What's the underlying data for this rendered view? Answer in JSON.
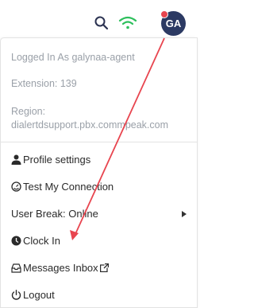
{
  "header": {
    "avatar_initials": "GA",
    "icons": [
      "search-icon",
      "wifi-icon"
    ],
    "status_dot_color": "#e8454f",
    "wifi_color": "#2dbf5c",
    "avatar_color": "#2c3a63"
  },
  "menu": {
    "info": {
      "logged_in": "Logged In As galynaa-agent",
      "extension": "Extension: 139",
      "region_label": "Region:",
      "region_value": "dialertdsupport.pbx.commpeak.com"
    },
    "items": [
      {
        "label": "Profile settings",
        "icon": "user-icon"
      },
      {
        "label": "Test My Connection",
        "icon": "gauge-icon"
      },
      {
        "label": "User Break: Online",
        "icon": "caret-right-icon"
      },
      {
        "label": "Clock In",
        "icon": "clock-icon"
      },
      {
        "label": "Messages Inbox",
        "icon": "inbox-icon"
      },
      {
        "label": "Logout",
        "icon": "power-icon"
      }
    ]
  },
  "annotation": {
    "arrow_color": "#e8454f"
  }
}
